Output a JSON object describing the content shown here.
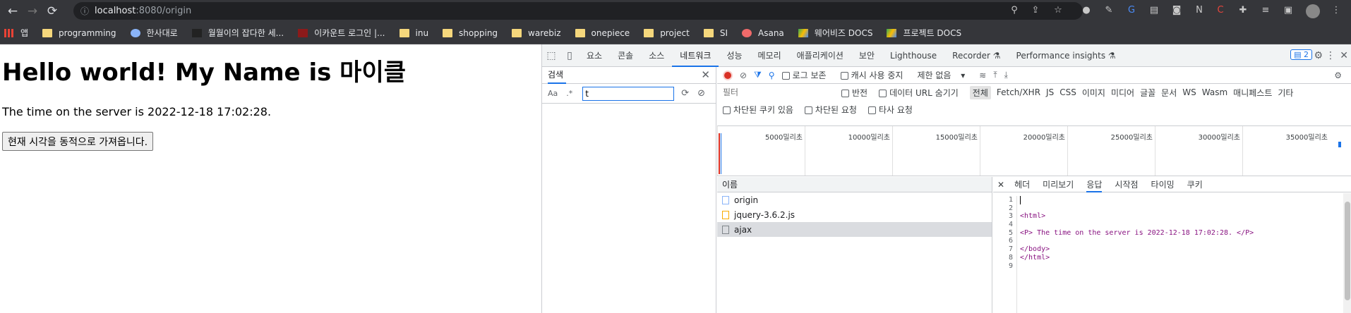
{
  "browser": {
    "url_host": "localhost",
    "url_path": ":8080/origin",
    "bookmarks": [
      "앱",
      "programming",
      "한사대로",
      "월월이의 잡다한 세...",
      "이카운트 로그인 |...",
      "inu",
      "shopping",
      "warebiz",
      "onepiece",
      "project",
      "SI",
      "Asana",
      "웨어비즈 DOCS",
      "프로젝트 DOCS"
    ]
  },
  "page": {
    "heading": "Hello world! My Name is 마이클",
    "time_text": "The time on the server is 2022-12-18 17:02:28.",
    "button_label": "현재 시각을 동적으로 가져옵니다."
  },
  "devtools": {
    "tabs": [
      "요소",
      "콘솔",
      "소스",
      "네트워크",
      "성능",
      "메모리",
      "애플리케이션",
      "보안",
      "Lighthouse",
      "Recorder ⚗",
      "Performance insights ⚗"
    ],
    "active_tab": "네트워크",
    "badge_count": "2",
    "search": {
      "label": "검색",
      "opt1": "Aa",
      "opt2": ".*",
      "query": "t"
    },
    "toolbar": {
      "preserve_log": "로그 보존",
      "disable_cache": "캐시 사용 중지",
      "throttle": "제한 없음"
    },
    "filter": {
      "placeholder": "필터",
      "invert": "반전",
      "hide_data": "데이터 URL 숨기기",
      "types": [
        "전체",
        "Fetch/XHR",
        "JS",
        "CSS",
        "이미지",
        "미디어",
        "글꼴",
        "문서",
        "WS",
        "Wasm",
        "매니페스트",
        "기타"
      ],
      "blocked_cookies": "차단된 쿠키 있음",
      "blocked_requests": "차단된 요청",
      "third_party": "타사 요청"
    },
    "timeline_ticks": [
      "5000밀리초",
      "10000밀리초",
      "15000밀리초",
      "20000밀리초",
      "25000밀리초",
      "30000밀리초",
      "35000밀리초"
    ],
    "names_header": "이름",
    "requests": [
      "origin",
      "jquery-3.6.2.js",
      "ajax"
    ],
    "detail_tabs": [
      "헤더",
      "미리보기",
      "응답",
      "시작점",
      "타이밍",
      "쿠키"
    ],
    "active_detail": "응답",
    "code_lines": [
      "",
      "",
      "<html>",
      "",
      "<P>  The time on the server is 2022-12-18 17:02:28. </P>",
      "",
      "</body>",
      "</html>",
      ""
    ],
    "line_numbers": [
      "1",
      "2",
      "3",
      "4",
      "5",
      "6",
      "7",
      "8",
      "9"
    ]
  }
}
